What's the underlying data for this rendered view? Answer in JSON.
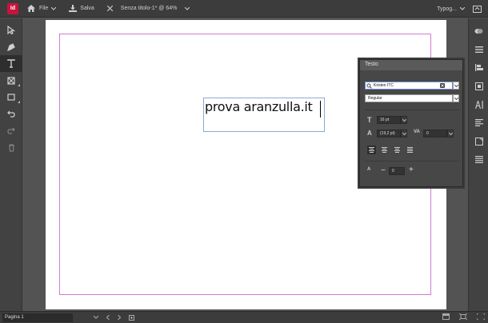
{
  "app": {
    "logo": "Id"
  },
  "topbar": {
    "file_label": "File",
    "save_label": "Salva",
    "doc_title": "Senza titolo-1* @ 64%",
    "workspace_label": "Typog..."
  },
  "document": {
    "text_content": "prova aranzulla.it"
  },
  "text_panel": {
    "title": "Testo",
    "font_family": "Kristen ITC",
    "font_style": "Regular",
    "font_size": "16 pt",
    "leading": "(19,2 pt)",
    "tracking": "0",
    "baseline_shift": "0"
  },
  "status": {
    "page_label": "Pagina 1"
  },
  "colors": {
    "accent": "#c8143c",
    "margin_guide": "#d27ad2",
    "frame_border": "#8ea9d8"
  }
}
